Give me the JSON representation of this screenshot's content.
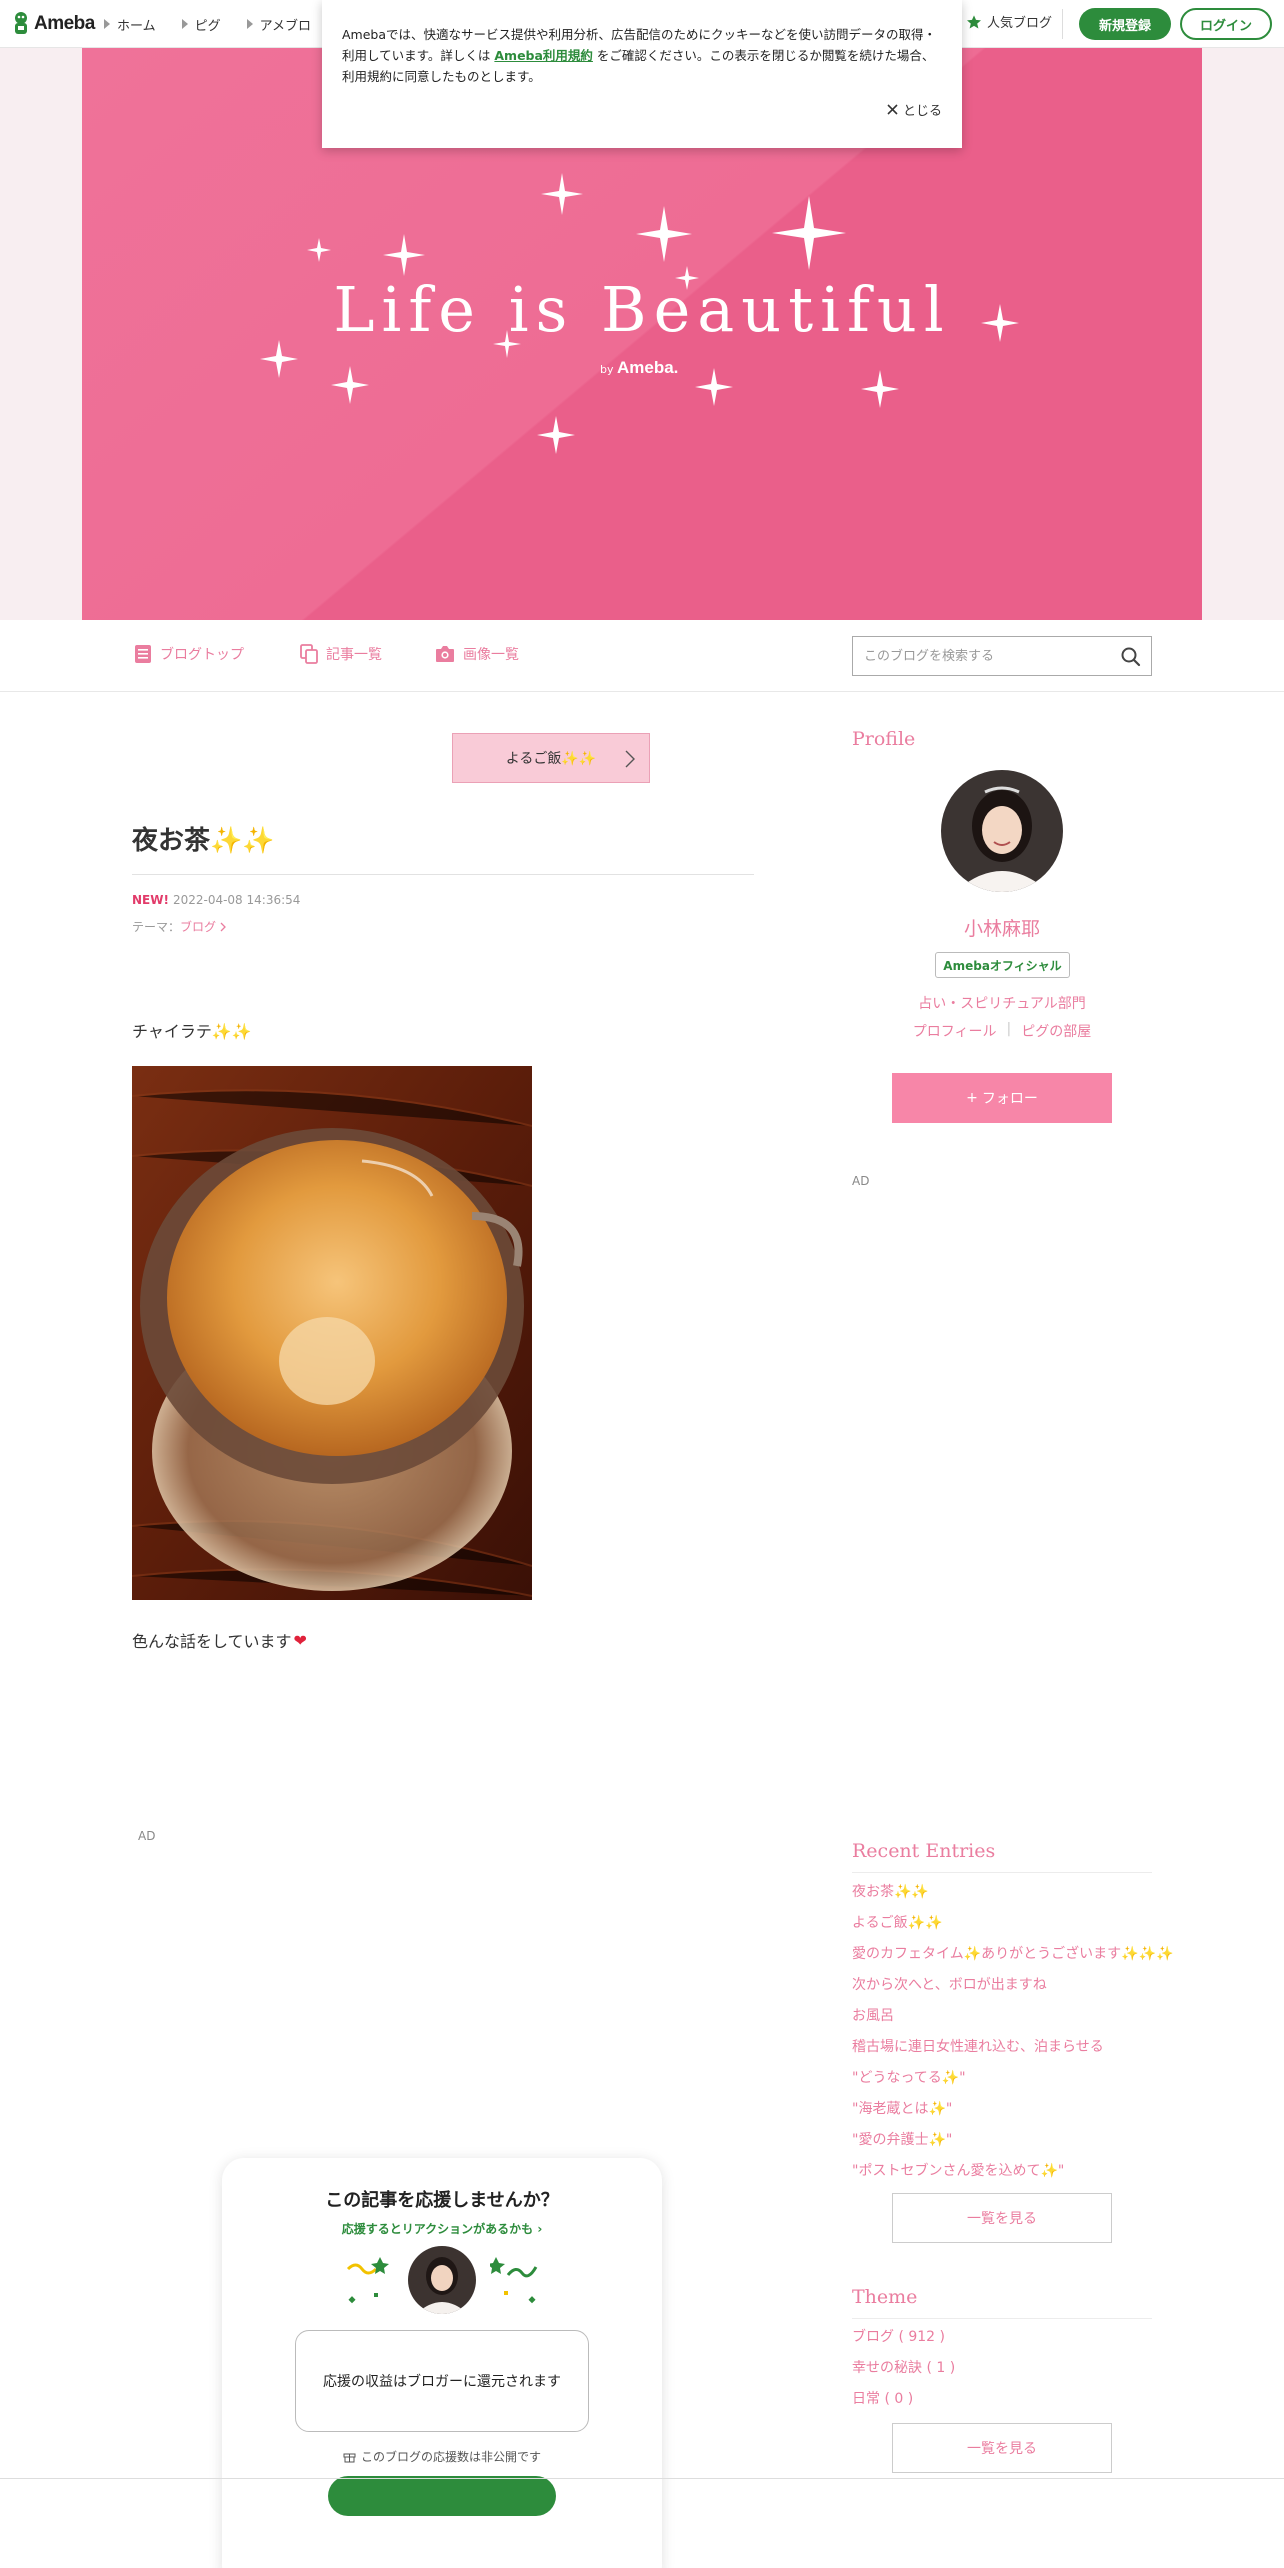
{
  "topbar": {
    "logo": "Ameba",
    "nav": [
      {
        "label": "ホーム"
      },
      {
        "label": "ピグ"
      },
      {
        "label": "アメブロ"
      }
    ],
    "popular_label": "人気ブログ",
    "signup_label": "新規登録",
    "login_label": "ログイン",
    "brand_color": "#2d8c3c"
  },
  "cookie": {
    "text_before": "Amebaでは、快適なサービス提供や利用分析、広告配信のためにクッキーなどを使い訪問データの取得・利用しています。詳しくは",
    "link": "Ameba利用規約",
    "text_after": "をご確認ください。この表示を閉じるか閲覧を続けた場合、利用規約に同意したものとします。",
    "close_label": "とじる"
  },
  "banner": {
    "title": "Life is Beautiful",
    "by": "by",
    "brand": "Ameba.",
    "color": "#ee6c94"
  },
  "blognav": {
    "items": [
      {
        "label": "ブログトップ",
        "icon": "document-icon"
      },
      {
        "label": "記事一覧",
        "icon": "copy-icon"
      },
      {
        "label": "画像一覧",
        "icon": "camera-icon"
      }
    ],
    "search_placeholder": "このブログを検索する",
    "accent_color": "#ea7d9f"
  },
  "article": {
    "prev_label": "よるご飯✨✨",
    "title": "夜お茶✨✨",
    "new_label": "NEW!",
    "date": "2022-04-08 14:36:54",
    "theme_prefix": "テーマ：",
    "theme": "ブログ",
    "p1_text": "チャイラテ",
    "p1_emoji": "✨✨",
    "p2_text": "色んな話をしています",
    "p2_emoji": "❤",
    "ad_label": "AD"
  },
  "support": {
    "title": "この記事を応援しませんか？",
    "link": "応援するとリアクションがあるかも",
    "box_text": "応援の収益はブロガーに還元されます",
    "count_text": "このブログの応援数は非公開です"
  },
  "sidebar": {
    "profile_heading": "Profile",
    "name": "小林麻耶",
    "badge": "Amebaオフィシャル",
    "category": "占い・スピリチュアル部門",
    "profile_link": "プロフィール",
    "room_link": "ピグの部屋",
    "follow_label": "フォロー",
    "ad_label": "AD",
    "recent_heading": "Recent Entries",
    "recent": [
      "夜お茶✨✨",
      "よるご飯✨✨",
      "愛のカフェタイム✨ありがとうございます✨✨✨",
      "次から次へと、ボロが出ますね",
      "お風呂",
      "稽古場に連日女性連れ込む、泊まらせる",
      "\"どうなってる✨\"",
      "\"海老蔵とは✨\"",
      "\"愛の弁護士✨\"",
      "\"ポストセブンさん愛を込めて✨\""
    ],
    "recent_more": "一覧を見る",
    "theme_heading": "Theme",
    "themes": [
      "ブログ ( 912 )",
      "幸せの秘訣 ( 1 )",
      "日常 ( 0 )"
    ],
    "theme_more": "一覧を見る"
  }
}
